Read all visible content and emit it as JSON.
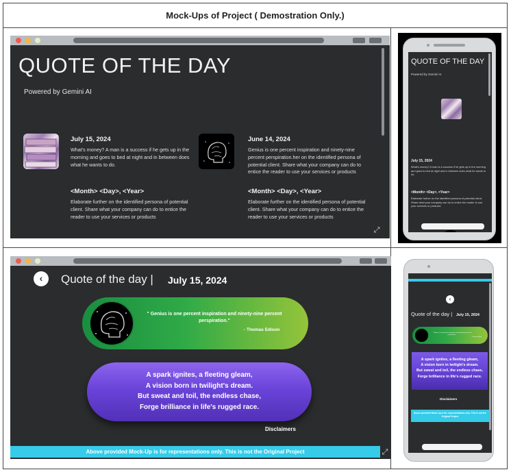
{
  "table": {
    "heading": "Mock-Ups of Project ( Demostration Only.)"
  },
  "mockup1": {
    "title": "QUOTE OF THE DAY",
    "powered": "Powered by Gemini AI",
    "cards": [
      {
        "date": "July 15, 2024",
        "text": "What's money? A man is a success if he gets up in the morning and goes to bed at night and in between does what he wants to do."
      },
      {
        "date": "June 14, 2024",
        "text": "Genius is one percent inspiration and ninety-nine percent perspiration.her on the identified persona of potential client. Share what your company can do to entice the reader to use your services or products"
      },
      {
        "date": "<Month> <Day>, <Year>",
        "text": "Elaborate further on the identified persona of potential client. Share what your company can do to entice the reader to use your services or products"
      },
      {
        "date": "<Month> <Day>, <Year>",
        "text": "Elaborate further on the identified persona of potential client. Share what your company can do to entice the reader to use your services or products"
      }
    ]
  },
  "mockup2": {
    "title": "QUOTE OF THE DAY",
    "powered": "Powered by Gemini AI",
    "card1": {
      "date": "July 15, 2024",
      "text": "What's money? A man is a success if he gets up in the morning and goes to bed at night and in between does what he wants to do."
    },
    "card2": {
      "date": "<Month> <Day>, <Year>",
      "text": "Elaborate further on the identified persona of potential client. Share what your company can do to entice the reader to use your services or products"
    }
  },
  "mockup3": {
    "back_glyph": "‹",
    "title": "Quote of the day |",
    "date": "July 15, 2024",
    "quote": "\" Genius is one percent inspiration and ninety-nine percent perspiration.\"",
    "author": "- Thomas Edison",
    "poem": [
      "A spark ignites, a fleeting gleam,",
      "A vision born in twilight's dream.",
      "But sweat and toil, the endless chase,",
      "Forge brilliance in life's rugged race."
    ],
    "disclaimers": "Disclaimers",
    "banner": "Above provided Mock-Up is for representations only. This is not the Original Project"
  },
  "mockup4": {
    "back_glyph": "‹",
    "title": "Quote of the day |",
    "date": "July 15, 2024",
    "poem": [
      "A spark ignites, a fleeting gleam,",
      "A vision born in twilight's dream.",
      "But sweat and toil, the endless chase,",
      "Forge brilliance in life's rugged race."
    ],
    "disclaimers": "Disclaimers",
    "banner": "Above provided Mock-Up is for representations only. This is not the Original Project"
  },
  "icons": {
    "expand": "⤢"
  },
  "colors": {
    "screen_bg": "#2a2c2e",
    "accent_cyan": "#35cbe9",
    "green_start": "#1a8d40",
    "green_end": "#95c43a",
    "purple": "#6a44d9"
  }
}
